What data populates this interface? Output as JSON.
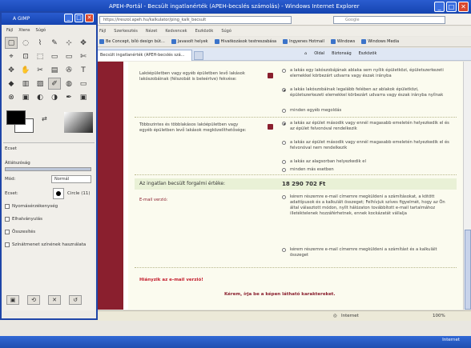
{
  "ie": {
    "title": "APEH-Portál - Becsült ingatlanérték (APEH-becslés számolás) - Windows Internet Explorer",
    "address": "https://ireszol.apeh.hu/kalkulator/ping_kalk_becsult",
    "search_placeholder": "Google",
    "menu": [
      "Fájl",
      "Szerkesztés",
      "Nézet",
      "Kedvencek",
      "Eszközök",
      "Súgó"
    ],
    "favorites": [
      "Be Concept, bíló design bút...",
      "Javasolt helyek",
      "Hivatkozások testreszabása",
      "Ingyenes Hotmail",
      "Windows",
      "Windows Media"
    ],
    "tab_label": "Becsült ingatlanérték (APEH-becslés szá...",
    "cmd": [
      "Oldal",
      "Biztonság",
      "Eszközök"
    ],
    "status_text": "Internet",
    "zoom": "100%",
    "tray_text": "Internet"
  },
  "page": {
    "q1_label": "Lakóépületben vagy egyéb épületben levő lakások lakószobáinak (félszobát is beleértve) fekvése:",
    "q1_opts": [
      {
        "text": "a lakás egy lakószobájának ablaka sem nyílik épületközi, épületszerkezeti elemekkel körbezárt udvarra vagy észak irányba",
        "on": false
      },
      {
        "text": "a lakás lakószobáinak legalább felében az ablakok épületközi, épületszerkezeti elemekkel körbezárt udvarra vagy észak irányba nyílnak",
        "on": true
      },
      {
        "text": "minden egyéb megoldás",
        "on": false
      }
    ],
    "q2_label": "Többszintes és többlakásos lakóépületben vagy egyéb épületben levő lakások megközelíthetősége:",
    "q2_opts": [
      {
        "text": "a lakás az épület második vagy ennél magasabb emeletén helyezkedik el és az épület felvonóval rendelkezik",
        "on": true
      },
      {
        "text": "a lakás az épület második vagy ennél magasabb emeletén helyezkedik el és felvonóval nem rendelkezik",
        "on": false
      },
      {
        "text": "a lakás az alagsorban helyezkedik el",
        "on": false
      },
      {
        "text": "minden más esetben",
        "on": false
      }
    ],
    "price_label": "Az ingatlan becsült forgalmi értéke:",
    "price_value": "18 290 702 Ft",
    "email_label": "E-mail verzió:",
    "email_opt1": "kérem részemre e-mail címemre megküldeni a számításokat, a kötött adattípusok és a kalkulált összeget; Felhívjuk szíves figyelmét, hogy az Ön által választott módon, nyílt hálózaton továbbított e-mail tartalmához illetéktelenek hozzáférhetnek, ennek kockázatát vállalja",
    "email_opt2": "kérem részemre e-mail címemre megküldeni a számítást és a kalkulált összeget",
    "error1": "Hiányzik az e-mail verzió!",
    "error2": "Kérem, írja be a képen látható karaktereket."
  },
  "gimp": {
    "title": "A GIMP",
    "menu": [
      "Fájl",
      "Xtens",
      "Súgó"
    ],
    "tools": [
      "▢",
      "◌",
      "⌇",
      "✎",
      "⊹",
      "✥",
      "⌖",
      "⊡",
      "⬚",
      "▭",
      "▭",
      "✄",
      "✥",
      "✋",
      "✂",
      "▤",
      "✇",
      "T",
      "◆",
      "▥",
      "▨",
      "✐",
      "◍",
      "▭",
      "⊗",
      "▣",
      "◐",
      "◑",
      "✒",
      "▣"
    ],
    "dock_title": "Ecset",
    "opacity_label": "Átlátszóság",
    "mode_label": "Mód:",
    "mode_value": "Normál",
    "brush_label": "Ecset:",
    "brush_value": "Circle (11)",
    "checks": [
      "Nyomásérzékenység",
      "Elhalványulás",
      "Összesítés",
      "Színátmenet színének használata"
    ]
  }
}
